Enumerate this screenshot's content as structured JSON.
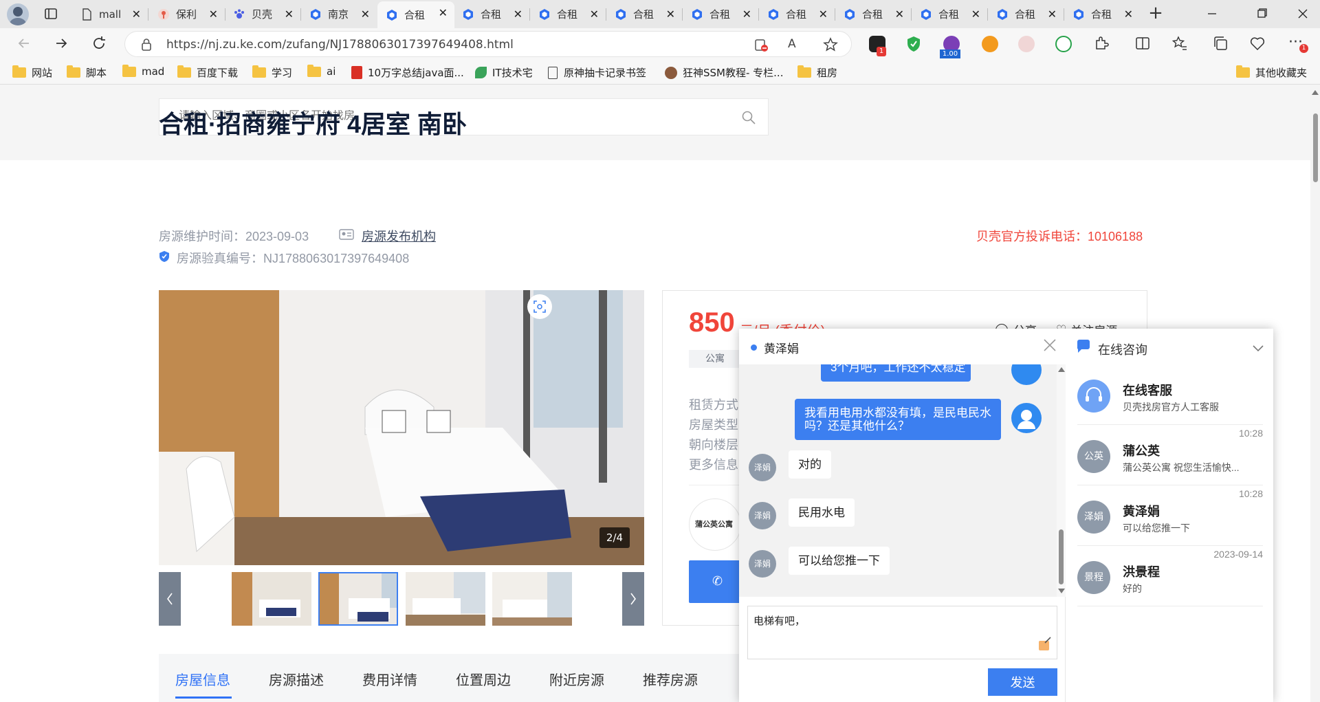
{
  "browser": {
    "tabs": [
      {
        "title": "mall",
        "icon": "document-icon"
      },
      {
        "title": "保利",
        "icon": "map-pin-icon"
      },
      {
        "title": "贝壳",
        "icon": "paw-icon"
      },
      {
        "title": "南京",
        "icon": "ke-hexagon-icon"
      },
      {
        "title": "合租",
        "icon": "ke-hexagon-icon",
        "active": true
      },
      {
        "title": "合租",
        "icon": "ke-hexagon-icon"
      },
      {
        "title": "合租",
        "icon": "ke-hexagon-icon"
      },
      {
        "title": "合租",
        "icon": "ke-hexagon-icon"
      },
      {
        "title": "合租",
        "icon": "ke-hexagon-icon"
      },
      {
        "title": "合租",
        "icon": "ke-hexagon-icon"
      },
      {
        "title": "合租",
        "icon": "ke-hexagon-icon"
      },
      {
        "title": "合租",
        "icon": "ke-hexagon-icon"
      },
      {
        "title": "合租",
        "icon": "ke-hexagon-icon"
      },
      {
        "title": "合租",
        "icon": "ke-hexagon-icon"
      }
    ],
    "new_tab_label": "+",
    "url": "https://nj.zu.ke.com/zufang/NJ1788063017397649408.html",
    "zoom_badge": "1.00",
    "ext_badge_1": "1",
    "ext_badge_2": "1",
    "bookmarks": [
      {
        "label": "网站",
        "icon": "folder-icon"
      },
      {
        "label": "脚本",
        "icon": "folder-icon"
      },
      {
        "label": "mad",
        "icon": "folder-icon"
      },
      {
        "label": "百度下载",
        "icon": "folder-icon"
      },
      {
        "label": "学习",
        "icon": "folder-icon"
      },
      {
        "label": "ai",
        "icon": "folder-icon"
      },
      {
        "label": "10万字总结java面...",
        "icon": "pdf-icon"
      },
      {
        "label": "IT技术宅",
        "icon": "leaf-icon"
      },
      {
        "label": "原神抽卡记录书签",
        "icon": "page-icon"
      },
      {
        "label": "狂神SSM教程- 专栏...",
        "icon": "avatar-icon"
      },
      {
        "label": "租房",
        "icon": "folder-icon"
      }
    ],
    "other_bookmarks": "其他收藏夹"
  },
  "page": {
    "search_placeholder": "请输入区域、商圈或小区名开始找房",
    "title": "合租·招商雍宁府 4居室 南卧",
    "maintain_time": "房源维护时间：2023-09-03",
    "publisher_link": "房源发布机构",
    "verify_no": "房源验真编号：NJ1788063017397649408",
    "complaint_phone": "贝壳官方投诉电话：10106188",
    "gallery_counter": "2/4",
    "price": "850",
    "price_unit": "元/月 (季付价)",
    "share_label": "分享",
    "follow_label": "关注房源",
    "tag": "公寓",
    "info_labels": [
      "租赁方式：",
      "房屋类型：",
      "朝向楼层：",
      "更多信息："
    ],
    "agency_logo_text": "蒲公英公寓",
    "tabs": [
      "房屋信息",
      "房源描述",
      "费用详情",
      "位置周边",
      "附近房源",
      "推荐房源"
    ]
  },
  "chat": {
    "contact_name": "黄泽娟",
    "messages": [
      {
        "from": "me",
        "text": "3个月吧，工作还不太稳定"
      },
      {
        "from": "me",
        "text": "我看用电用水都没有填，是民电民水吗？还是其他什么？"
      },
      {
        "from": "other",
        "avatar": "泽娟",
        "text": "对的"
      },
      {
        "from": "other",
        "avatar": "泽娟",
        "text": "民用水电"
      },
      {
        "from": "other",
        "avatar": "泽娟",
        "text": "可以给您推一下"
      }
    ],
    "input_value": "电梯有吧，",
    "send_label": "发送",
    "panel_title": "在线咨询",
    "conversations": [
      {
        "avatar": "",
        "name": "在线客服",
        "preview": "贝壳找房官方人工客服",
        "time": ""
      },
      {
        "avatar": "公英",
        "name": "蒲公英",
        "preview": "蒲公英公寓 祝您生活愉快...",
        "time": "10:28"
      },
      {
        "avatar": "泽娟",
        "name": "黄泽娟",
        "preview": "可以给您推一下",
        "time": "10:28"
      },
      {
        "avatar": "景程",
        "name": "洪景程",
        "preview": "好的",
        "time": "2023-09-14"
      }
    ]
  }
}
